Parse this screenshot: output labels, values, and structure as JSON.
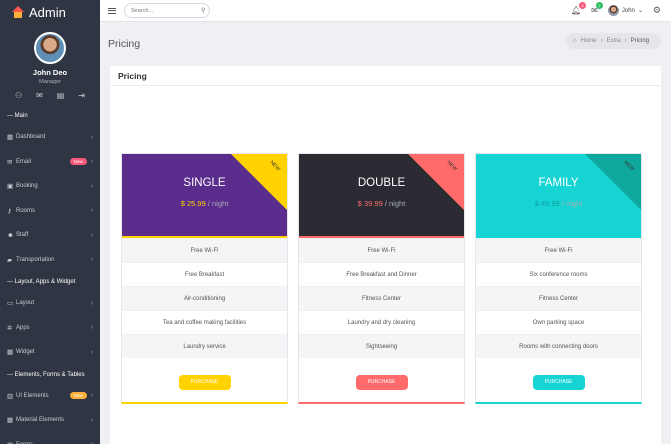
{
  "app": {
    "title": "Admin"
  },
  "profile": {
    "name": "John Deo",
    "role": "Manager",
    "icons": [
      "user-icon",
      "mail-icon",
      "chat-icon",
      "logout-icon"
    ]
  },
  "sidebar": {
    "header_main": "--- Main",
    "items": [
      {
        "label": "Dashboard",
        "icon": "grid-icon",
        "glyph": "▦"
      },
      {
        "label": "Email",
        "icon": "mail-icon",
        "glyph": "✉",
        "badge": "New",
        "badge_color": "#f7597a"
      },
      {
        "label": "Booking",
        "icon": "briefcase-icon",
        "glyph": "▣"
      },
      {
        "label": "Rooms",
        "icon": "key-icon",
        "glyph": "⚷"
      },
      {
        "label": "Staff",
        "icon": "users-icon",
        "glyph": "☻"
      },
      {
        "label": "Transportation",
        "icon": "car-icon",
        "glyph": "▰"
      }
    ],
    "header_layout": "--- Layout, Apps & Widget",
    "items2": [
      {
        "label": "Layout",
        "icon": "monitor-icon",
        "glyph": "▭"
      },
      {
        "label": "Apps",
        "icon": "apps-icon",
        "glyph": "✲"
      },
      {
        "label": "Widget",
        "icon": "widget-icon",
        "glyph": "▦"
      }
    ],
    "header_elements": "--- Elements, Forms & Tables",
    "items3": [
      {
        "label": "UI Elements",
        "icon": "ui-icon",
        "glyph": "▥",
        "badge": "New",
        "badge_color": "#fbb03b"
      },
      {
        "label": "Material Elements",
        "icon": "material-icon",
        "glyph": "▦"
      },
      {
        "label": "Forms",
        "icon": "forms-icon",
        "glyph": "▤"
      }
    ]
  },
  "topbar": {
    "search_placeholder": "Search...",
    "notification_count": "6",
    "notification_color": "#f7597a",
    "messages_count": "2",
    "messages_color": "#2dbe60",
    "user_name": "John"
  },
  "page": {
    "title": "Pricing",
    "breadcrumb": [
      "Home",
      "Extra",
      "Pricing"
    ],
    "card_title": "Pricing"
  },
  "plans": [
    {
      "name": "SINGLE",
      "price": "$ 25.99",
      "per": "/ night",
      "ribbon": "NEW",
      "bg": "#5a2d8c",
      "ribbon_color": "#ffd200",
      "price_color": "#ffd200",
      "name_color": "#ffffff",
      "button_color": "#ffd200",
      "button_label": "PURCHASE",
      "features": [
        "Free Wi-Fi",
        "Free Breakfast",
        "Air-conditioning",
        "Tea and coffee making facilities",
        "Laundry service"
      ]
    },
    {
      "name": "DOUBLE",
      "price": "$ 39.99",
      "per": "/ night",
      "ribbon": "NEW",
      "bg": "#2a2b33",
      "ribbon_color": "#ff6a6a",
      "price_color": "#ff6a6a",
      "name_color": "#ffffff",
      "button_color": "#ff6a6a",
      "button_label": "PURCHASE",
      "features": [
        "Free Wi-Fi",
        "Free Breakfast and Dinner",
        "Fitness Center",
        "Laundry and dry cleaning",
        "Sightseeing"
      ]
    },
    {
      "name": "FAMILY",
      "price": "$ 49.99",
      "per": "/ night",
      "ribbon": "NEW",
      "bg": "#17d4d4",
      "ribbon_color": "#0fa89c",
      "price_color": "#0f9e9e",
      "name_color": "#ffffff",
      "button_color": "#17d4d4",
      "button_label": "PURCHASE",
      "features": [
        "Free Wi-Fi",
        "Six conference rooms",
        "Fitness Center",
        "Own parking space",
        "Rooms with connecting doors"
      ]
    }
  ]
}
